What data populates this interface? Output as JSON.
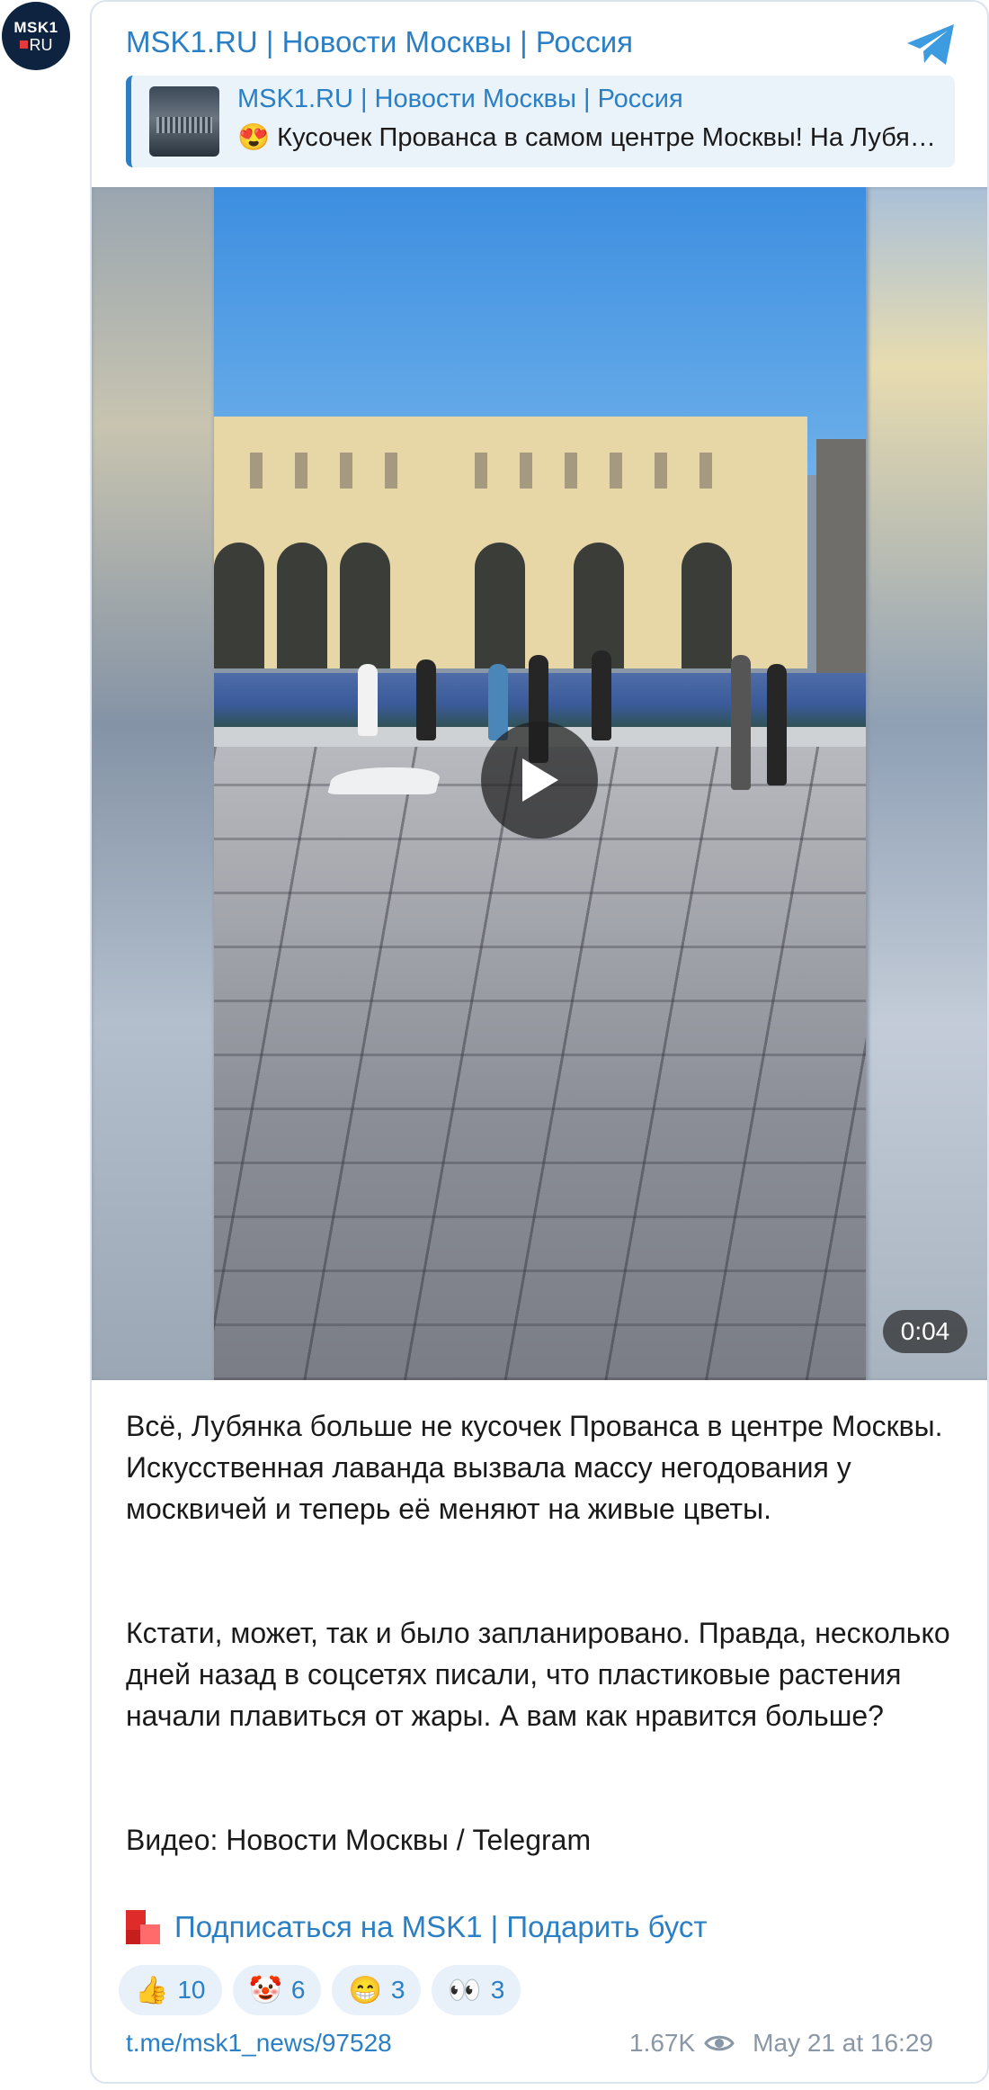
{
  "avatar": {
    "line1": "MSK1",
    "line2": "RU"
  },
  "header": {
    "channel_name": "MSK1.RU | Новости Москвы | Россия"
  },
  "reply": {
    "title": "MSK1.RU | Новости Москвы | Россия",
    "emoji": "😍",
    "text": "Кусочек Прованса в самом центре Москвы! На Лубянской площади высадили лаванду"
  },
  "video": {
    "duration": "0:04"
  },
  "post": {
    "paragraph1": "Всё, Лубянка больше не кусочек Прованса в центре Москвы. Искусственная лаванда вызвала массу негодования у москвичей и теперь её меняют на живые цветы.",
    "paragraph2": "Кстати, может, так и было запланировано. Правда, несколько дней назад в соцсетях писали, что пластиковые растения начали плавиться от жары. А вам как нравится больше?",
    "paragraph3": "Видео: Новости Москвы / Telegram"
  },
  "subscribe": {
    "label": "Подписаться на MSK1 | Подарить буст"
  },
  "reactions": [
    {
      "emoji": "👍",
      "count": "10",
      "icon": "thumbs-up-icon"
    },
    {
      "emoji": "🤡",
      "count": "6",
      "icon": "clown-icon"
    },
    {
      "emoji": "😁",
      "count": "3",
      "icon": "grin-icon"
    },
    {
      "emoji": "👀",
      "count": "3",
      "icon": "eyes-icon"
    }
  ],
  "footer": {
    "link": "t.me/msk1_news/97528",
    "views": "1.67K",
    "date": "May 21 at 16:29"
  },
  "colors": {
    "accent": "#2a7fc5",
    "reaction_bg": "#e8f1fa",
    "muted": "#8a97a6"
  }
}
